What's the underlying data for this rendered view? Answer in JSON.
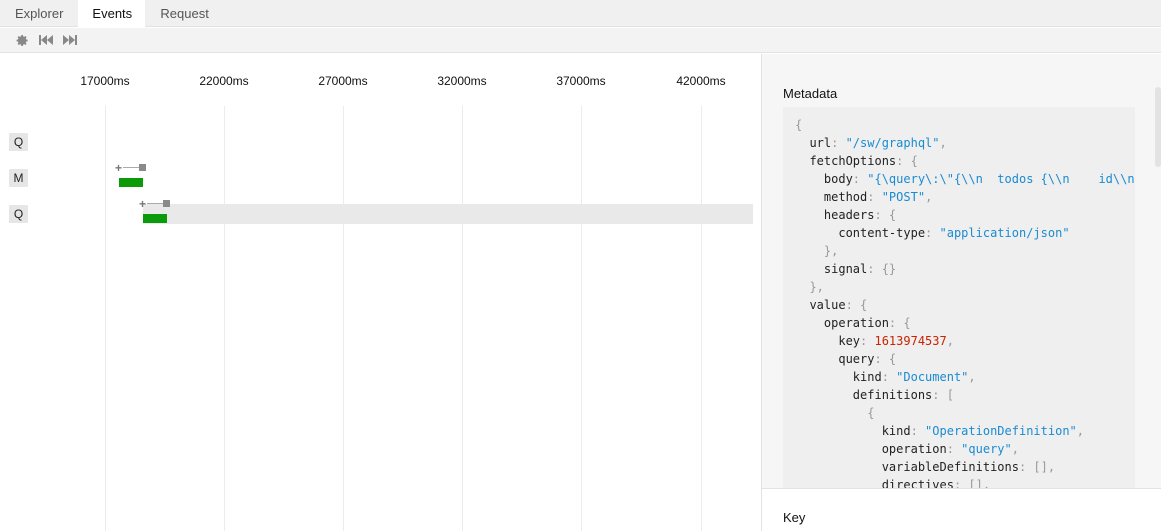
{
  "tabs": [
    {
      "label": "Explorer",
      "active": false
    },
    {
      "label": "Events",
      "active": true
    },
    {
      "label": "Request",
      "active": false
    }
  ],
  "toolbar": {
    "settings_icon": "gear-icon",
    "previous_icon": "skip-back-icon",
    "next_icon": "skip-forward-icon"
  },
  "timeline": {
    "ticks": [
      "17000ms",
      "22000ms",
      "27000ms",
      "32000ms",
      "37000ms",
      "42000ms"
    ],
    "rows": [
      {
        "label": "Q"
      },
      {
        "label": "M"
      },
      {
        "label": "Q"
      }
    ]
  },
  "metadata": {
    "title": "Metadata",
    "key_title": "Key",
    "lines": [
      [
        [
          "p",
          "{"
        ]
      ],
      [
        [
          "k",
          "  url"
        ],
        [
          "p",
          ": "
        ],
        [
          "s",
          "\"/sw/graphql\""
        ],
        [
          "p",
          ","
        ]
      ],
      [
        [
          "k",
          "  fetchOptions"
        ],
        [
          "p",
          ": {"
        ]
      ],
      [
        [
          "k",
          "    body"
        ],
        [
          "p",
          ": "
        ],
        [
          "s",
          "\"{\\query\\:\\\"{\\\\n  todos {\\\\n    id\\\\n"
        ]
      ],
      [
        [
          "k",
          "    method"
        ],
        [
          "p",
          ": "
        ],
        [
          "s",
          "\"POST\""
        ],
        [
          "p",
          ","
        ]
      ],
      [
        [
          "k",
          "    headers"
        ],
        [
          "p",
          ": {"
        ]
      ],
      [
        [
          "k",
          "      content-type"
        ],
        [
          "p",
          ": "
        ],
        [
          "s",
          "\"application/json\""
        ]
      ],
      [
        [
          "p",
          "    },"
        ]
      ],
      [
        [
          "k",
          "    signal"
        ],
        [
          "p",
          ": {}"
        ]
      ],
      [
        [
          "p",
          "  },"
        ]
      ],
      [
        [
          "k",
          "  value"
        ],
        [
          "p",
          ": {"
        ]
      ],
      [
        [
          "k",
          "    operation"
        ],
        [
          "p",
          ": {"
        ]
      ],
      [
        [
          "k",
          "      key"
        ],
        [
          "p",
          ": "
        ],
        [
          "n",
          "1613974537"
        ],
        [
          "p",
          ","
        ]
      ],
      [
        [
          "k",
          "      query"
        ],
        [
          "p",
          ": {"
        ]
      ],
      [
        [
          "k",
          "        kind"
        ],
        [
          "p",
          ": "
        ],
        [
          "s",
          "\"Document\""
        ],
        [
          "p",
          ","
        ]
      ],
      [
        [
          "k",
          "        definitions"
        ],
        [
          "p",
          ": ["
        ]
      ],
      [
        [
          "p",
          "          {"
        ]
      ],
      [
        [
          "k",
          "            kind"
        ],
        [
          "p",
          ": "
        ],
        [
          "s",
          "\"OperationDefinition\""
        ],
        [
          "p",
          ","
        ]
      ],
      [
        [
          "k",
          "            operation"
        ],
        [
          "p",
          ": "
        ],
        [
          "s",
          "\"query\""
        ],
        [
          "p",
          ","
        ]
      ],
      [
        [
          "k",
          "            variableDefinitions"
        ],
        [
          "p",
          ": [],"
        ]
      ],
      [
        [
          "k",
          "            directives"
        ],
        [
          "p",
          ": [],"
        ]
      ]
    ]
  },
  "colors": {
    "accent_green": "#0a9a0a",
    "string_blue": "#1a8bd1",
    "number_red": "#cc2200"
  }
}
